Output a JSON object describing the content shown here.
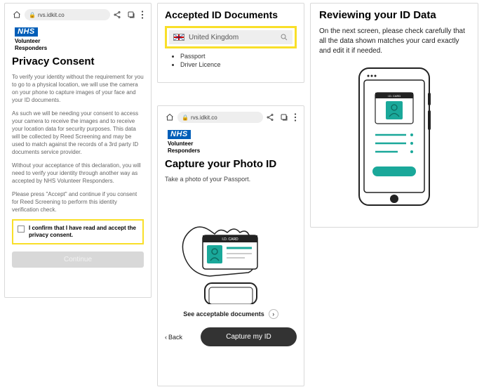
{
  "browser": {
    "url": "rvs.idkit.co"
  },
  "logo": {
    "nhs": "NHS",
    "line1": "Volunteer",
    "line2": "Responders"
  },
  "privacy": {
    "title": "Privacy Consent",
    "p1": "To verify your identity without the requirement for you to go to a physical location, we will use the camera on your phone to capture images of your face and your ID documents.",
    "p2": "As such we will be needing your consent to access your camera to receive the images and to receive your location data for security purposes. This data will be collected by Reed Screening and may be used to match against the records of a 3rd party ID documents service provider.",
    "p3": "Without your acceptance of this declaration, you will need to verify your identity through another way as accepted by NHS Volunteer Responders.",
    "p4": "Please press \"Accept\" and continue if you consent for Reed Screening to perform this identity verification check.",
    "checkbox_label": "I confirm that I have read and accept the privacy consent.",
    "continue": "Continue"
  },
  "accepted": {
    "title": "Accepted ID Documents",
    "country": "United Kingdom",
    "items": [
      "Passport",
      "Driver Licence"
    ]
  },
  "capture": {
    "title": "Capture your Photo ID",
    "subtitle": "Take a photo of your Passport.",
    "see_docs": "See acceptable documents",
    "back": "Back",
    "button": "Capture my ID",
    "card_label": "I.D. CARD"
  },
  "review": {
    "title": "Reviewing your ID Data",
    "body": "On the next screen, please check carefully that all the data shown matches your card exactly and edit it if needed.",
    "card_label": "I.D. CARD"
  }
}
